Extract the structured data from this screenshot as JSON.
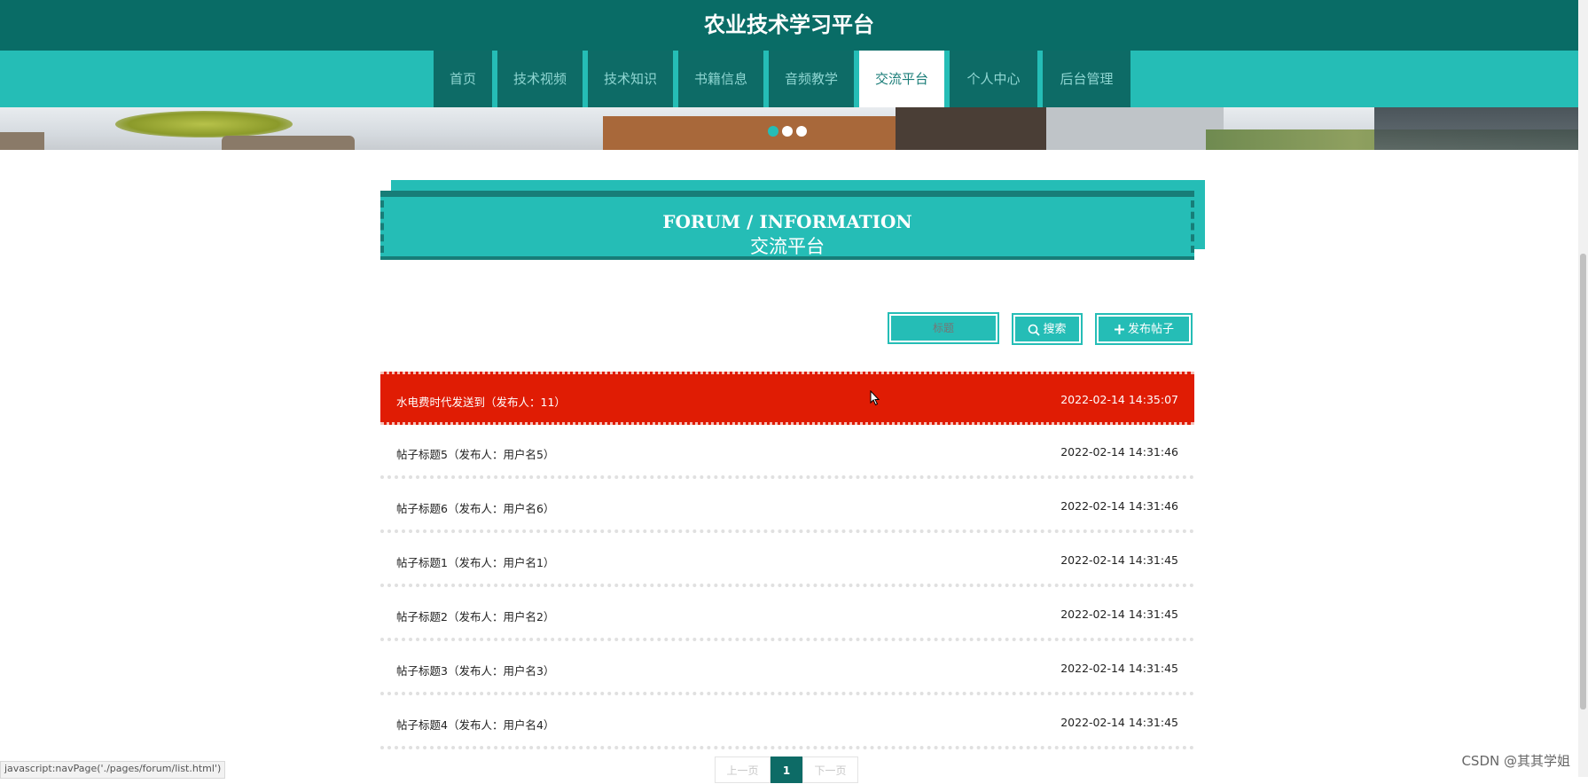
{
  "header": {
    "title": "农业技术学习平台"
  },
  "nav": {
    "items": [
      {
        "label": "首页",
        "active": false
      },
      {
        "label": "技术视频",
        "active": false
      },
      {
        "label": "技术知识",
        "active": false
      },
      {
        "label": "书籍信息",
        "active": false
      },
      {
        "label": "音频教学",
        "active": false
      },
      {
        "label": "交流平台",
        "active": true
      },
      {
        "label": "个人中心",
        "active": false
      },
      {
        "label": "后台管理",
        "active": false
      }
    ]
  },
  "section": {
    "title_en": "FORUM / INFORMATION",
    "title_cn": "交流平台"
  },
  "search": {
    "placeholder": "标题",
    "search_label": "搜索",
    "add_label": "发布帖子"
  },
  "posts": [
    {
      "title": "水电费时代发送到（发布人：11）",
      "date": "2022-02-14 14:35:07",
      "highlight": true
    },
    {
      "title": "帖子标题5（发布人：用户名5）",
      "date": "2022-02-14 14:31:46",
      "highlight": false
    },
    {
      "title": "帖子标题6（发布人：用户名6）",
      "date": "2022-02-14 14:31:46",
      "highlight": false
    },
    {
      "title": "帖子标题1（发布人：用户名1）",
      "date": "2022-02-14 14:31:45",
      "highlight": false
    },
    {
      "title": "帖子标题2（发布人：用户名2）",
      "date": "2022-02-14 14:31:45",
      "highlight": false
    },
    {
      "title": "帖子标题3（发布人：用户名3）",
      "date": "2022-02-14 14:31:45",
      "highlight": false
    },
    {
      "title": "帖子标题4（发布人：用户名4）",
      "date": "2022-02-14 14:31:45",
      "highlight": false
    }
  ],
  "pagination": {
    "prev": "上一页",
    "current": "1",
    "next": "下一页"
  },
  "status_bar": "javascript:navPage('./pages/forum/list.html')",
  "watermark": "CSDN @其其学姐",
  "colors": {
    "dark_teal": "#096c66",
    "teal": "#25bdb6",
    "highlight_red": "#e01c04"
  }
}
